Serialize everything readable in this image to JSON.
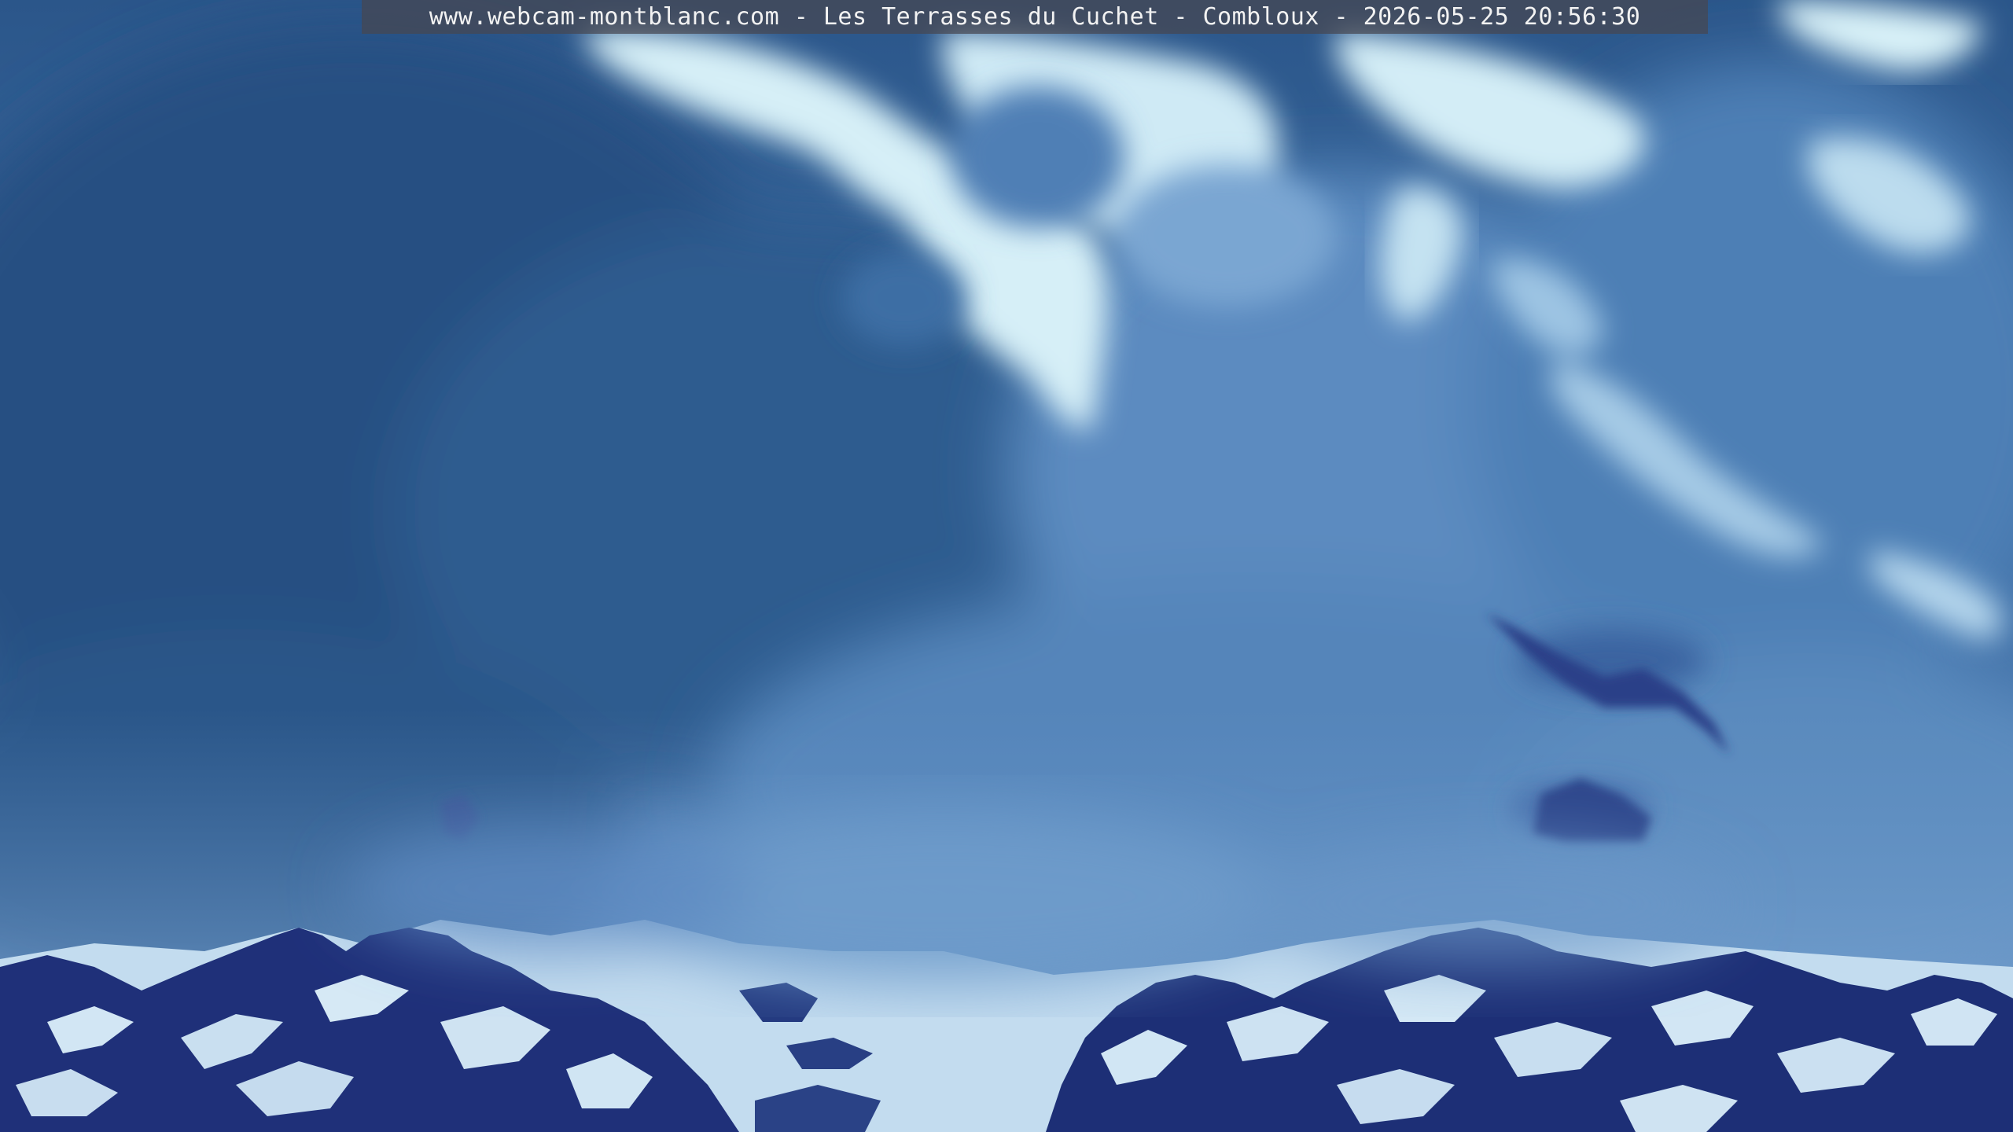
{
  "caption": {
    "text": "www.webcam-montblanc.com - Les Terrasses du Cuchet - Combloux - 2026-05-25 20:56:30"
  },
  "scene": {
    "description_icon": "webcam-mountain-landscape",
    "colors": {
      "sky_clear": "#d8f1f8",
      "cloud_dark": "#2b568a",
      "cloud_mid": "#4d7cb2",
      "cloud_light": "#9cc2e2",
      "snow": "#cfe4f2",
      "rock": "#1c2e74"
    }
  }
}
